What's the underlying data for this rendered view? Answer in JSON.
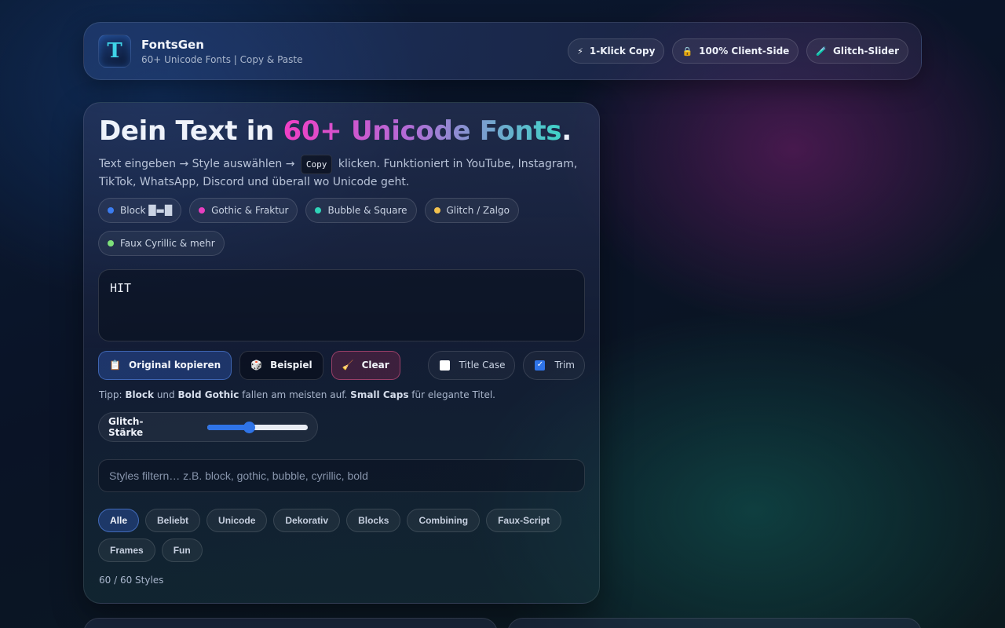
{
  "header": {
    "logo_letter": "T",
    "title": "FontsGen",
    "subtitle": "60+ Unicode Fonts | Copy & Paste",
    "badges": [
      {
        "icon": "lightning-icon",
        "glyph": "⚡",
        "label": "1-Klick Copy"
      },
      {
        "icon": "lock-icon",
        "glyph": "🔒",
        "label": "100% Client-Side"
      },
      {
        "icon": "test-tube-icon",
        "glyph": "🧪",
        "label": "Glitch-Slider"
      }
    ]
  },
  "hero": {
    "title_pre": "Dein Text in ",
    "title_accent": "60+ Unicode Fonts",
    "title_post": ".",
    "intro_pre": "Text eingeben → Style auswählen → ",
    "intro_kbd": "Copy",
    "intro_post": " klicken. Funktioniert in YouTube, Instagram, TikTok, WhatsApp, Discord und überall wo Unicode geht."
  },
  "categories": [
    {
      "label": "Block █▬█",
      "color": "#3b7cf0"
    },
    {
      "label": "Gothic & Fraktur",
      "color": "#e83fc0"
    },
    {
      "label": "Bubble & Square",
      "color": "#2fd4b8"
    },
    {
      "label": "Glitch / Zalgo",
      "color": "#f2c14e"
    },
    {
      "label": "Faux Cyrillic & mehr",
      "color": "#7ee07a"
    }
  ],
  "input": {
    "value": "HIT"
  },
  "actions": {
    "copy": {
      "glyph": "📋",
      "label": "Original kopieren"
    },
    "example": {
      "glyph": "🎲",
      "label": "Beispiel"
    },
    "clear": {
      "glyph": "🧹",
      "label": "Clear"
    },
    "title_case": {
      "label": "Title Case",
      "checked": false
    },
    "trim": {
      "label": "Trim",
      "checked": true
    }
  },
  "tip": {
    "pre": "Tipp: ",
    "b1": "Block",
    "mid1": " und ",
    "b2": "Bold Gothic",
    "mid2": " fallen am meisten auf. ",
    "b3": "Small Caps",
    "post": " für elegante Titel."
  },
  "glitch": {
    "label": "Glitch-Stärke",
    "value": 0.41
  },
  "filter": {
    "placeholder": "Styles filtern… z.B. block, gothic, bubble, cyrillic, bold",
    "value": ""
  },
  "tabs": [
    "Alle",
    "Beliebt",
    "Unicode",
    "Dekorativ",
    "Blocks",
    "Combining",
    "Faux-Script",
    "Frames",
    "Fun"
  ],
  "active_tab": 0,
  "count": "60 / 60 Styles"
}
